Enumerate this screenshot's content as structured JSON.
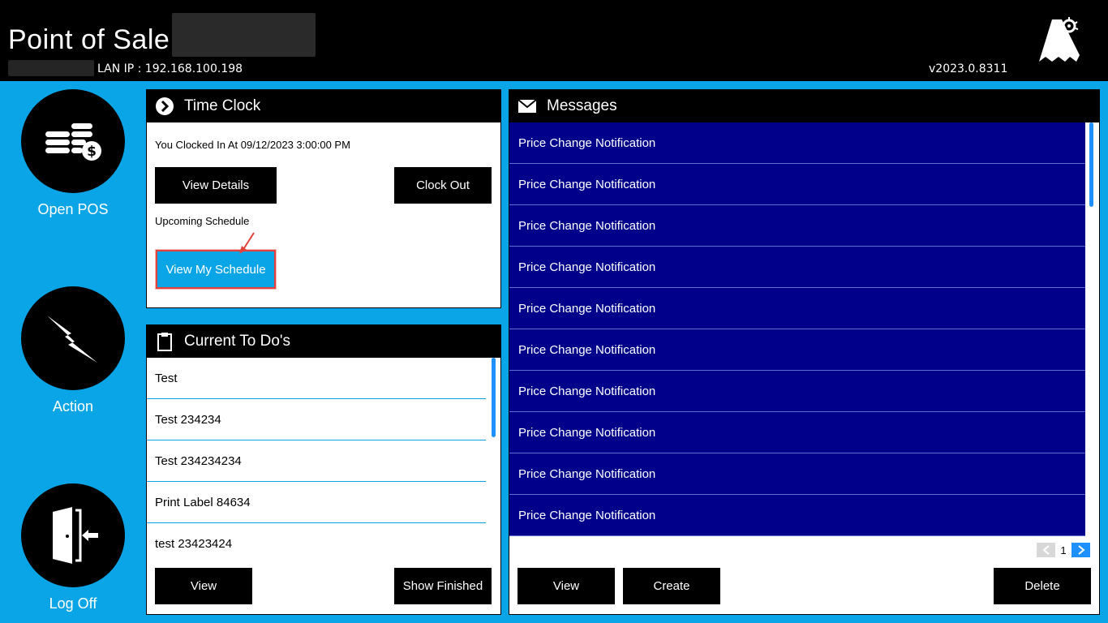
{
  "header": {
    "title": "Point of Sale",
    "lan_ip": "LAN IP : 192.168.100.198",
    "version": "v2023.0.8311"
  },
  "nav": {
    "open_pos": "Open POS",
    "action": "Action",
    "log_off": "Log Off"
  },
  "time_clock": {
    "title": "Time Clock",
    "status": "You Clocked In At 09/12/2023 3:00:00 PM",
    "view_details": "View Details",
    "clock_out": "Clock Out",
    "upcoming_label": "Upcoming Schedule",
    "view_schedule": "View My Schedule"
  },
  "todos": {
    "title": "Current To Do's",
    "items": [
      "Test",
      "Test 234234",
      "Test 234234234",
      "Print Label 84634",
      "test 23423424"
    ],
    "view": "View",
    "show_finished": "Show Finished"
  },
  "messages": {
    "title": "Messages",
    "items": [
      "Price Change Notification",
      "Price Change Notification",
      "Price Change Notification",
      "Price Change Notification",
      "Price Change Notification",
      "Price Change Notification",
      "Price Change Notification",
      "Price Change Notification",
      "Price Change Notification",
      "Price Change Notification"
    ],
    "page": "1",
    "view": "View",
    "create": "Create",
    "delete": "Delete"
  },
  "colors": {
    "background": "#0aa5e6",
    "message_bg": "#00008b",
    "highlight": "#e0413b"
  }
}
